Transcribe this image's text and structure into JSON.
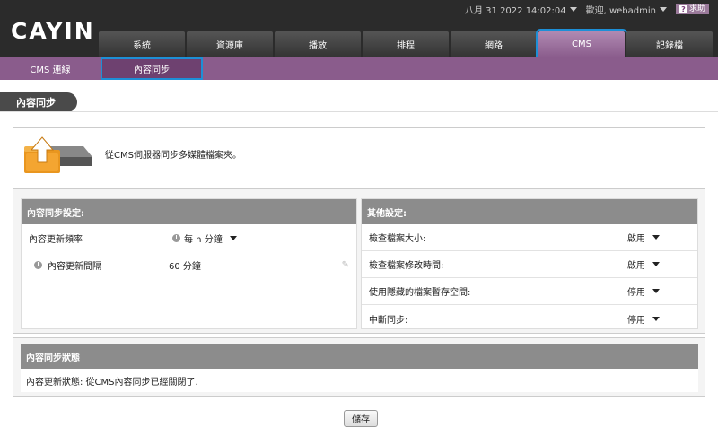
{
  "brand": "CAYIN",
  "topbar": {
    "datetime": "八月 31 2022 14:02:04",
    "welcome": "歡迎, webadmin",
    "help": "求助"
  },
  "tabs": [
    "系統",
    "資源庫",
    "播放",
    "排程",
    "網路",
    "CMS",
    "記錄檔"
  ],
  "active_tab": "CMS",
  "subnav": [
    "CMS 連線",
    "內容同步"
  ],
  "page_title": "內容同步",
  "info_text": "從CMS伺服器同步多媒體檔案夾。",
  "left_panel": {
    "title": "內容同步設定:",
    "rows": [
      {
        "label": "內容更新頻率",
        "value": "每 n 分鐘"
      },
      {
        "label": "內容更新間隔",
        "value": "60 分鐘"
      }
    ]
  },
  "right_panel": {
    "title": "其他設定:",
    "rows": [
      {
        "label": "檢查檔案大小:",
        "value": "啟用"
      },
      {
        "label": "檢查檔案修改時間:",
        "value": "啟用"
      },
      {
        "label": "使用隱藏的檔案暫存空間:",
        "value": "停用"
      },
      {
        "label": "中斷同步:",
        "value": "停用"
      }
    ]
  },
  "status": {
    "title": "內容同步狀態",
    "text": "內容更新狀態: 從CMS內容同步已經關閉了."
  },
  "save_label": "儲存",
  "icons": {
    "help": "question-icon",
    "clock": "clock-icon",
    "edit": "pencil-icon",
    "dropdown": "caret-down-icon",
    "sync": "upload-folder-icon"
  }
}
